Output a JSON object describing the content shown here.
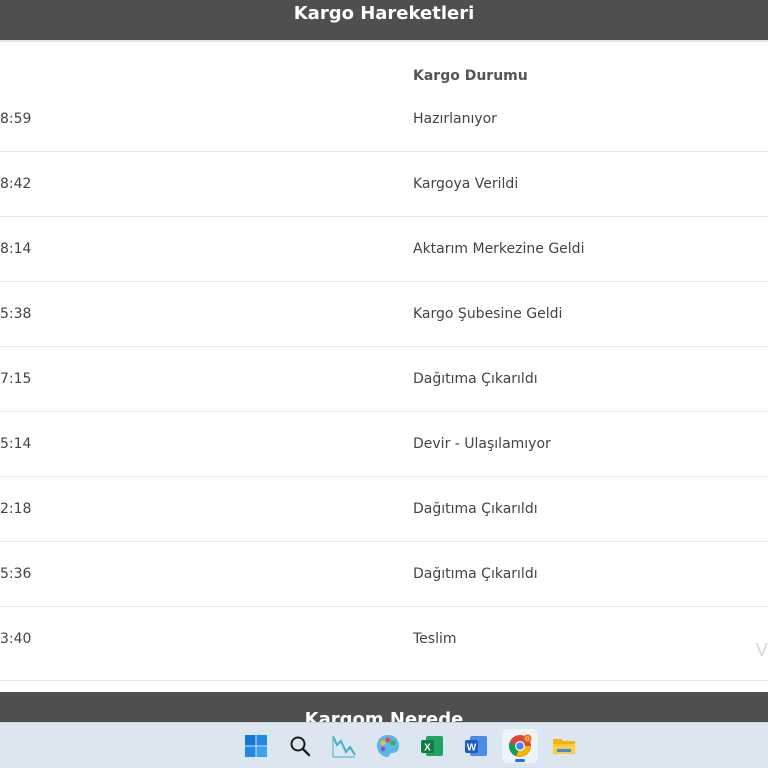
{
  "header": {
    "title": "Kargo Hareketleri"
  },
  "table": {
    "status_column_header": "Kargo Durumu",
    "rows": [
      {
        "time": "8:59",
        "status": "Hazırlanıyor"
      },
      {
        "time": "8:42",
        "status": "Kargoya Verildi"
      },
      {
        "time": "8:14",
        "status": "Aktarım Merkezine Geldi"
      },
      {
        "time": "5:38",
        "status": "Kargo Şubesine Geldi"
      },
      {
        "time": "7:15",
        "status": "Dağıtıma Çıkarıldı"
      },
      {
        "time": "5:14",
        "status": "Devir - Ulaşılamıyor"
      },
      {
        "time": "2:18",
        "status": "Dağıtıma Çıkarıldı"
      },
      {
        "time": "5:36",
        "status": "Dağıtıma Çıkarıldı"
      },
      {
        "time": "3:40",
        "status": "Teslim"
      }
    ]
  },
  "watermark": {
    "text": "V"
  },
  "next_section": {
    "title": "Kargom Nerede"
  },
  "taskbar": {
    "icons": [
      "windows-start-icon",
      "search-icon",
      "chart-app-icon",
      "paint-app-icon",
      "excel-icon",
      "word-icon",
      "chrome-icon",
      "file-explorer-icon"
    ],
    "active_icon": "chrome-icon",
    "accent_color": "#1a73e8"
  },
  "colors": {
    "header_bg": "#4f4f4f",
    "header_text": "#ffffff",
    "body_text": "#444444",
    "row_divider": "#e7e7e7",
    "taskbar_bg": "#dbe6f1"
  }
}
